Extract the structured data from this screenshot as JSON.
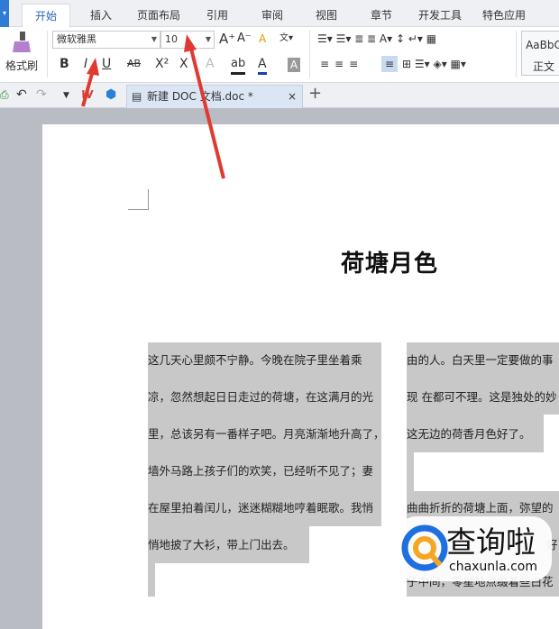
{
  "menu_tabs": [
    "开始",
    "插入",
    "页面布局",
    "引用",
    "审阅",
    "视图",
    "章节",
    "开发工具",
    "特色应用"
  ],
  "ribbon": {
    "format_painter": "格式刷",
    "font_name": "微软雅黑",
    "font_size": "10",
    "bold": "B",
    "italic": "I",
    "underline": "U",
    "strike": "AB",
    "superscript": "X²",
    "subscript": "X",
    "style_preview": "AaBbC",
    "style_name": "正文"
  },
  "doc_tab": {
    "title": "新建 DOC 文档.doc *",
    "close": "×",
    "new": "+"
  },
  "document": {
    "title": "荷塘月色",
    "col1": [
      "这几天心里颇不宁静。今晚在院子里坐着乘",
      "凉，忽然想起日日走过的荷塘，在这满月的光",
      "里，总该另有一番样子吧。月亮渐渐地升高了，",
      "墙外马路上孩子们的欢笑，已经听不见了；妻",
      "在屋里拍着闰儿，迷迷糊糊地哼着眠歌。我悄",
      "悄地披了大衫，带上门出去。"
    ],
    "col2": [
      "由的人。白天里一定要做的事",
      "现 在都可不理。这是独处的妙",
      "这无边的荷香月色好了。",
      "曲曲折折的荷塘上面，弥望的",
      "好",
      "子中间，零星地点缀着些白花"
    ]
  },
  "watermark": {
    "name": "查询啦",
    "url": "chaxunla.com"
  },
  "colors": {
    "accent": "#2a64b8",
    "selection": "#c8c8c8",
    "arrow": "#e03a30"
  }
}
